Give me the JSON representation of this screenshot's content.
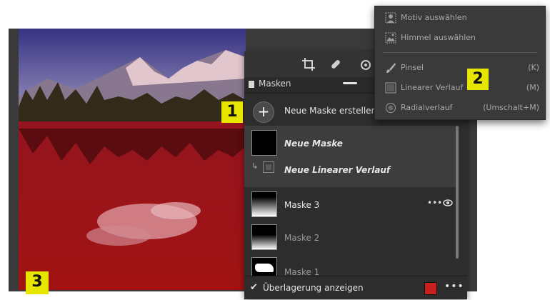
{
  "panel": {
    "header_title": "Masken",
    "new_mask_label": "Neue Maske erstellen",
    "masks": [
      {
        "name": "Neue Maske",
        "sub": "Neue Linearer Verlauf"
      },
      {
        "name": "Maske 3",
        "more": "•••"
      },
      {
        "name": "Maske 2"
      },
      {
        "name": "Maske 1"
      }
    ],
    "footer": {
      "checkbox_mark": "✔",
      "overlay_label": "Überlagerung anzeigen",
      "overlay_color": "#c8201f",
      "more": "•••"
    }
  },
  "menu": {
    "items": [
      {
        "label": "Motiv auswählen",
        "shortcut": "",
        "icon": "person-icon"
      },
      {
        "label": "Himmel auswählen",
        "shortcut": "",
        "icon": "sky-icon"
      },
      {
        "label": "Pinsel",
        "shortcut": "(K)",
        "icon": "brush-icon"
      },
      {
        "label": "Linearer Verlauf",
        "shortcut": "(M)",
        "icon": "linear-gradient-icon"
      },
      {
        "label": "Radialverlauf",
        "shortcut": "(Umschalt+M)",
        "icon": "radial-gradient-icon"
      }
    ]
  },
  "callouts": [
    "1",
    "2",
    "3"
  ],
  "colors": {
    "callout_bg": "#e6e600",
    "mask_overlay": "#c8201f"
  }
}
